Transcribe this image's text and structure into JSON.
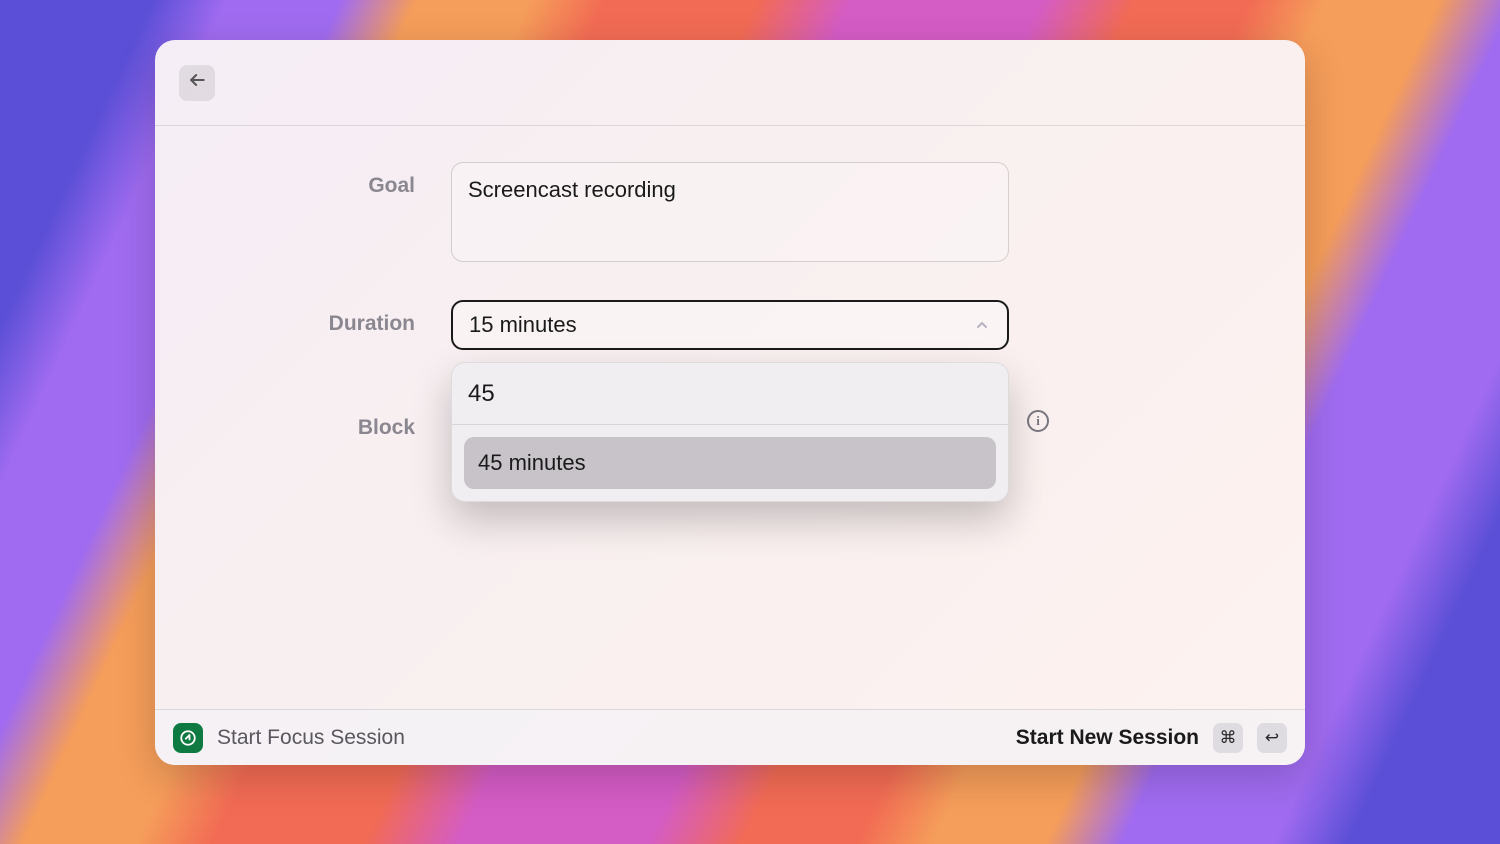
{
  "form": {
    "goal": {
      "label": "Goal",
      "value": "Screencast recording"
    },
    "duration": {
      "label": "Duration",
      "selected": "15 minutes",
      "search_value": "45",
      "options": [
        "45 minutes"
      ]
    },
    "block": {
      "label": "Block"
    }
  },
  "footer": {
    "app_title": "Start Focus Session",
    "primary_action": "Start New Session",
    "shortcut_mod": "⌘",
    "shortcut_key": "↩"
  }
}
